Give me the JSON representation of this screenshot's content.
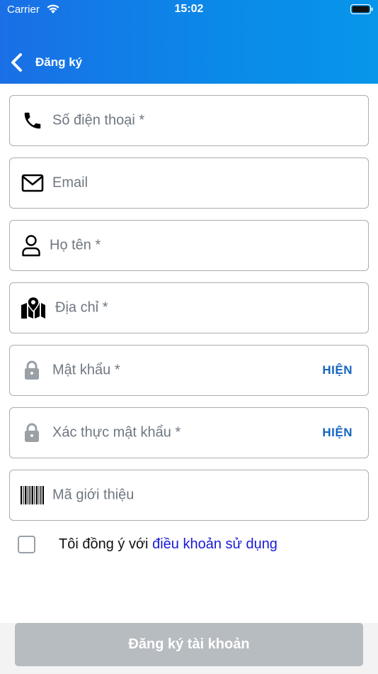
{
  "status_bar": {
    "carrier": "Carrier",
    "time": "15:02"
  },
  "nav": {
    "title": "Đăng ký",
    "back_icon": "chevron-left-icon"
  },
  "colors": {
    "header_start": "#1a6fe6",
    "header_end": "#0796ea",
    "link": "#1a1ad6",
    "show_label": "#1565c0",
    "button_disabled": "#b7bcc1"
  },
  "form": {
    "phone": {
      "placeholder": "Số điện thoại *",
      "icon": "phone-icon"
    },
    "email": {
      "placeholder": "Email",
      "icon": "envelope-icon"
    },
    "name": {
      "placeholder": "Họ tên *",
      "icon": "person-icon"
    },
    "address": {
      "placeholder": "Địa chỉ *",
      "icon": "map-pin-icon"
    },
    "password": {
      "placeholder": "Mật khẩu *",
      "icon": "lock-icon",
      "toggle_label": "HIỆN"
    },
    "confirm_password": {
      "placeholder": "Xác thực mật khẩu *",
      "icon": "lock-icon",
      "toggle_label": "HIỆN"
    },
    "referral": {
      "placeholder": "Mã giới thiệu",
      "icon": "barcode-icon"
    }
  },
  "agreement": {
    "text": "Tôi đồng ý với",
    "link": "điều khoản sử dụng",
    "checked": false
  },
  "submit": {
    "label": "Đăng ký tài khoản"
  }
}
